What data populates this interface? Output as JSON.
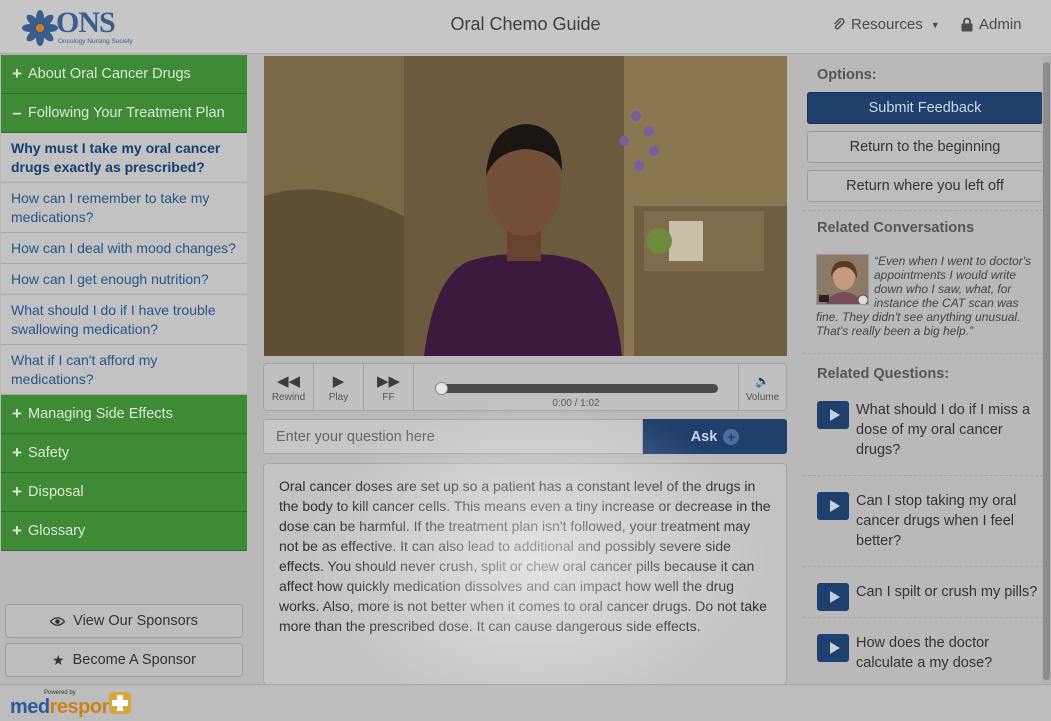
{
  "header": {
    "logo_text": "ONS",
    "logo_subtext": "Oncology Nursing Society",
    "title": "Oral Chemo Guide",
    "resources_label": "Resources",
    "admin_label": "Admin"
  },
  "left_nav": {
    "sections": [
      {
        "sign": "+",
        "label": "About Oral Cancer Drugs"
      },
      {
        "sign": "–",
        "label": "Following Your Treatment Plan"
      }
    ],
    "items": [
      {
        "label": "Why must I take my oral cancer drugs exactly as prescribed?",
        "active": true
      },
      {
        "label": "How can I remember to take my medications?"
      },
      {
        "label": "How can I deal with mood changes?"
      },
      {
        "label": "How can I get enough nutrition?"
      },
      {
        "label": "What should I do if I have trouble swallowing medication?"
      },
      {
        "label": "What if I can't afford my medications?"
      }
    ],
    "more_sections": [
      {
        "sign": "+",
        "label": "Managing Side Effects"
      },
      {
        "sign": "+",
        "label": "Safety"
      },
      {
        "sign": "+",
        "label": "Disposal"
      },
      {
        "sign": "+",
        "label": "Glossary"
      }
    ],
    "sponsor_view_label": "View Our Sponsors",
    "sponsor_become_label": "Become A Sponsor"
  },
  "player": {
    "rewind_label": "Rewind",
    "play_label": "Play",
    "ff_label": "FF",
    "volume_label": "Volume",
    "time": "0:00 / 1:02",
    "progress": 0
  },
  "ask": {
    "placeholder": "Enter your question here",
    "button_label": "Ask"
  },
  "answer_text": "Oral cancer doses are set up so a patient has a constant level of the drugs in the body to kill cancer cells. This means even a tiny increase or decrease in the dose can be harmful. If the treatment plan isn't followed, your treatment may not be as effective. It can also lead to additional and possibly severe side effects. You should never crush, split or chew oral cancer pills because it can affect how quickly medication dissolves and can impact how well the drug works. Also, more is not better when it comes to oral cancer drugs. Do not take more than the prescribed dose. It can cause dangerous side effects.",
  "right_panel": {
    "options_heading": "Options:",
    "submit_feedback": "Submit Feedback",
    "return_beginning": "Return to the beginning",
    "return_left_off": "Return where you left off",
    "related_conversations_heading": "Related Conversations",
    "conversation_quote": "“Even when I went to doctor's appointments I would write down who I saw, what, for instance the CAT scan was fine. They didn't see anything unusual. That's really been a big help.”",
    "related_questions_heading": "Related Questions:",
    "questions": [
      "What should I do if I miss a dose of my oral cancer drugs?",
      "Can I stop taking my oral cancer drugs when I feel better?",
      "Can I spilt or crush my pills?",
      "How does the doctor calculate a my dose?"
    ]
  },
  "footer": {
    "powered_by": "Powered by",
    "brand_part1": "med",
    "brand_part2": "respond"
  },
  "colors": {
    "nav_green": "#3f8a35",
    "primary_blue": "#1f3f6d",
    "link_blue": "#24558c"
  }
}
